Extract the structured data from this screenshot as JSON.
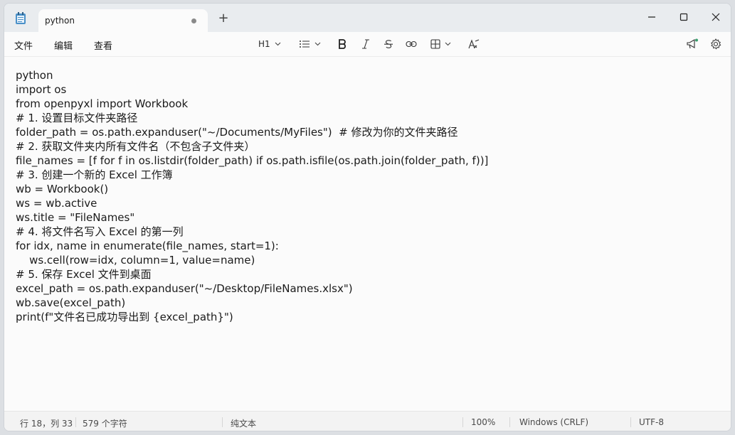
{
  "tab": {
    "title": "python"
  },
  "menu": [
    {
      "label": "文件"
    },
    {
      "label": "编辑"
    },
    {
      "label": "查看"
    }
  ],
  "toolbar": {
    "heading": "H1"
  },
  "editor": {
    "lines": [
      "python",
      "import os",
      "from openpyxl import Workbook",
      "# 1. 设置目标文件夹路径",
      "folder_path = os.path.expanduser(\"~/Documents/MyFiles\")  # 修改为你的文件夹路径",
      "# 2. 获取文件夹内所有文件名（不包含子文件夹）",
      "file_names = [f for f in os.listdir(folder_path) if os.path.isfile(os.path.join(folder_path, f))]",
      "# 3. 创建一个新的 Excel 工作簿",
      "wb = Workbook()",
      "ws = wb.active",
      "ws.title = \"FileNames\"",
      "# 4. 将文件名写入 Excel 的第一列",
      "for idx, name in enumerate(file_names, start=1):",
      "    ws.cell(row=idx, column=1, value=name)",
      "# 5. 保存 Excel 文件到桌面",
      "excel_path = os.path.expanduser(\"~/Desktop/FileNames.xlsx\")",
      "wb.save(excel_path)",
      "print(f\"文件名已成功导出到 {excel_path}\")"
    ]
  },
  "status": {
    "position": "行 18，列 33",
    "chars": "579 个字符",
    "format": "纯文本",
    "zoom": "100%",
    "line_ending": "Windows (CRLF)",
    "encoding": "UTF-8"
  },
  "colors": {
    "accent": "#3a86ff",
    "notify_dot": "#3a9f6e"
  }
}
